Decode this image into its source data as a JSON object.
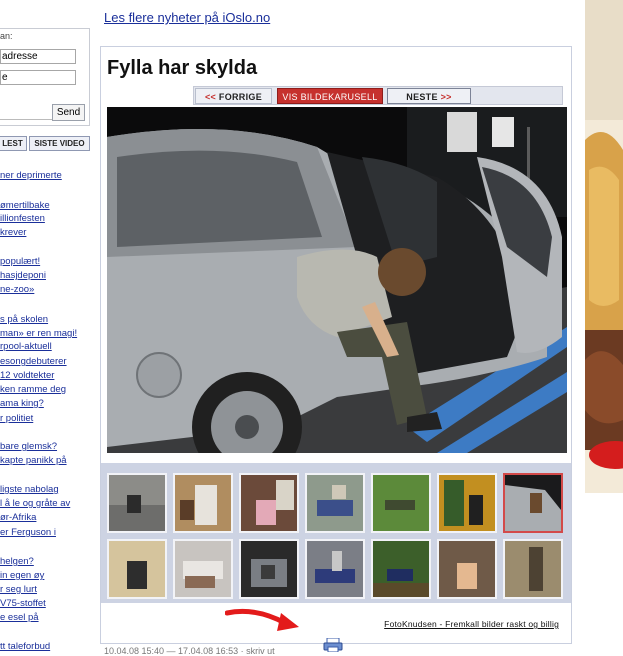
{
  "sidebar": {
    "form_label": "an:",
    "field1_value": "adresse",
    "field2_value": "e",
    "send_label": "Send",
    "tabs": [
      "LEST",
      "SISTE VIDEO"
    ],
    "news": [
      "ner deprimerte",
      "ømertilbake",
      "illionfesten",
      "krever",
      "populært!",
      "hasjdeponi",
      "ne-zoo»",
      "s på skolen",
      "man» er ren magi!",
      "rpool-aktuell",
      "esongdebuterer",
      "12 voldtekter",
      "ken ramme deg",
      "ama king?",
      "r politiet",
      "bare glemsk?",
      "kapte panikk på",
      "ligste nabolag",
      "l å le og gråte av",
      "ør-Afrika",
      "er Ferguson i",
      "helgen?",
      "in egen øy",
      "r seg lurt",
      "V75-stoffet",
      "e esel på",
      "tt taleforbud"
    ]
  },
  "main": {
    "top_link": "Les flere nyheter på iOslo.no",
    "title": "Fylla har skylda",
    "nav": {
      "prev_arrows": "<<",
      "prev_label": "FORRIGE",
      "carousel_label": "VIS BILDEKARUSELL",
      "next_label": "NESTE",
      "next_arrows": ">>"
    },
    "credit": "FotoKnudsen - Fremkall bilder raskt og billig",
    "bottom_text": "10.04.08 15:40 — 17.04.08 16:53 · skriv ut"
  },
  "colors": {
    "link": "#1a2f9a",
    "carousel_button": "#c6312e",
    "thumb_panel": "#cdd3e3",
    "selected_thumb_border": "#d34a4a",
    "annotation_arrow": "#e31b1b"
  },
  "icons": {
    "print": "printer-icon",
    "arrow": "red-arrow-annotation"
  }
}
